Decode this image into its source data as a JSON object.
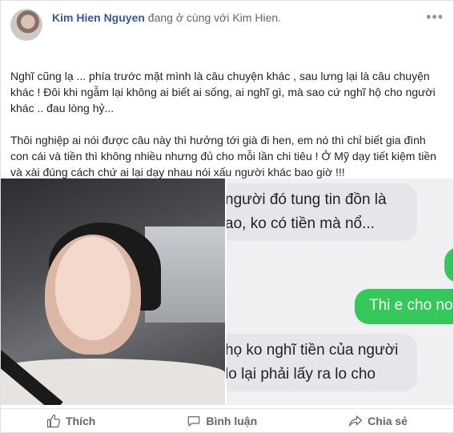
{
  "post": {
    "author": "Kim Hien Nguyen",
    "with_prefix": "đang ở cùng với",
    "tagged": "Kim Hien.",
    "text_p1": "Nghĩ cũng lạ ... phía trước mặt mình là câu chuyện khác , sau lưng lại là câu chuyện khác ! Đôi khi ngẫm lại không ai biết ai sống, ai nghĩ gì, mà sao cứ nghĩ hộ cho người khác .. đau lòng hỷ...",
    "text_p2": "Thôi nghiệp ai nói được câu này thì hưởng tới già đi hen, em nó thì chỉ biết gia đình con cái và tiền thì không nhiều nhưng đủ cho mỗi lần chi tiêu ! Ở Mỹ dạy tiết kiệm tiền và xài đúng cách chứ ai lại dạy nhau nói xấu người khác bao giờ !!!"
  },
  "chat": {
    "msg1_line1": "người đó tung tin đồn là",
    "msg1_line2": "ao, ko có tiền mà nổ...",
    "msg2": "Thi e cho no",
    "msg3_line1": "họ ko nghĩ tiền của người",
    "msg3_line2": "lo lại phải lấy ra lo cho"
  },
  "actions": {
    "like": "Thích",
    "comment": "Bình luận",
    "share": "Chia sẻ"
  },
  "colors": {
    "link": "#365899",
    "bubble_in": "#e5e5ea",
    "bubble_out": "#34c759"
  }
}
